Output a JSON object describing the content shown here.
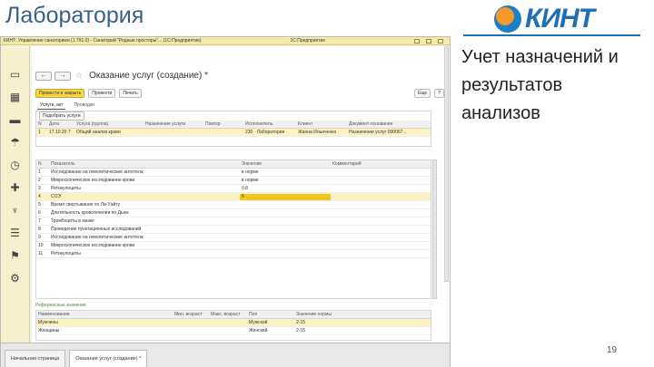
{
  "slide": {
    "title": "Лаборатория",
    "side_text": "Учет назначений и результатов анализов",
    "page_number": "19",
    "logo_text": "КИНТ"
  },
  "app": {
    "titlebar": [
      "КИНТ: Управление санаторием (1.791.0) - Санаторий \"Родные просторы\"... (1С:Предприятие)",
      "1С:Предприятие"
    ],
    "form_title": "Оказание услуг (создание) *",
    "toolbar": {
      "primary": "Провести и закрыть",
      "buttons": [
        "Провести",
        "Печать"
      ],
      "right_buttons": [
        "Еще",
        "?"
      ]
    },
    "tabs": [
      "Услуги, акт",
      "Проводки"
    ],
    "services": {
      "tool_label": "Подобрать услуги",
      "headers": [
        "N",
        "Дата",
        "Услуга (группа)",
        "Назначение услуги",
        "Повтор",
        "Исполнитель",
        "Клиент",
        "Документ-основание"
      ],
      "rows": [
        [
          "1",
          "17.10.20 7",
          "Общий анализ крови",
          "",
          "",
          "230 · Лаборатория",
          "Жанна Ильиченко",
          "Назначение услуг 000067..."
        ]
      ]
    },
    "results": {
      "headers": [
        "N",
        "Показатель",
        "Значение",
        "Комментарий"
      ],
      "rows": [
        [
          "1",
          "Исследование на гемолитические антитела",
          "в норме",
          ""
        ],
        [
          "2",
          "Микроскопическое исследование крови",
          "в норме",
          ""
        ],
        [
          "3",
          "Ретикулоциты",
          "0.8",
          ""
        ],
        [
          "4",
          "СОЭ",
          "5",
          ""
        ],
        [
          "5",
          "Время свертывания по Ли-Уайту",
          "",
          ""
        ],
        [
          "6",
          "Длительность кровотечения по Дьюк",
          "",
          ""
        ],
        [
          "7",
          "Тромбоциты в мазке",
          "",
          ""
        ],
        [
          "8",
          "Проведение пунктационных исследований",
          "",
          ""
        ],
        [
          "9",
          "Исследование на гемолитические антитела",
          "",
          ""
        ],
        [
          "10",
          "Микроскопическое исследование крови",
          "",
          ""
        ],
        [
          "11",
          "Ретикулоциты",
          "",
          ""
        ]
      ]
    },
    "reference": {
      "title": "Референсные значения",
      "headers": [
        "Наименование",
        "Мин. возраст",
        "Макс. возраст",
        "Пол",
        "Значение нормы"
      ],
      "rows": [
        [
          "Мужчины",
          "",
          "",
          "Мужской",
          "2-15"
        ],
        [
          "Женщины",
          "",
          "",
          "Женский",
          "2-15"
        ]
      ]
    },
    "bottom_tabs": [
      "Начальная страница",
      "Оказание услуг (создание) *"
    ]
  }
}
